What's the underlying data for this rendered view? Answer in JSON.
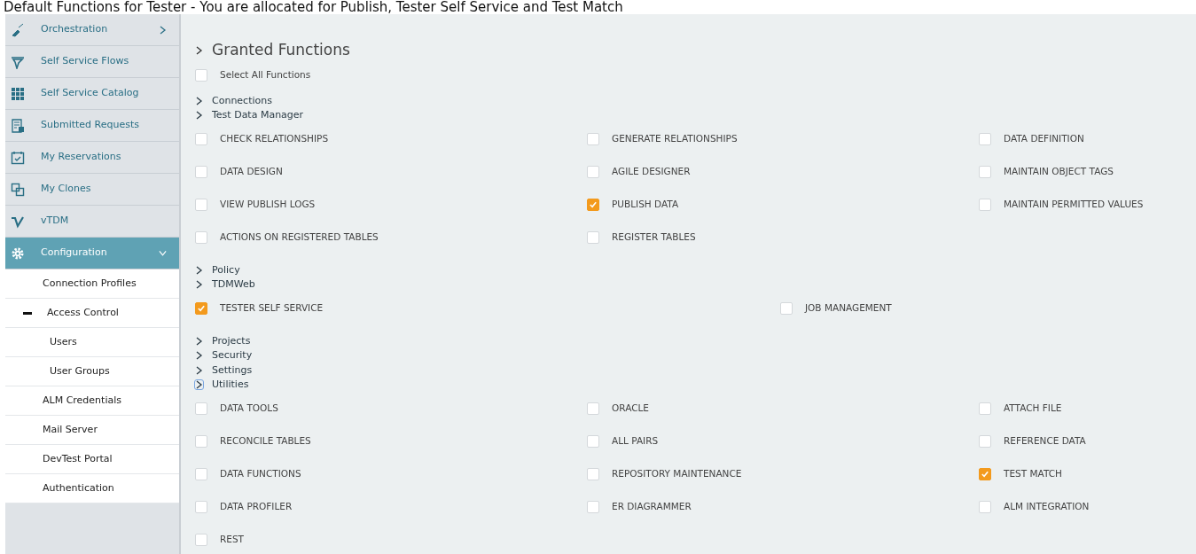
{
  "header": {
    "text": "Default Functions for Tester - You are allocated for Publish, Tester Self Service and Test Match"
  },
  "sidebar": {
    "items": [
      {
        "label": "Orchestration",
        "expanded": false,
        "selected": false
      },
      {
        "label": "Self Service Flows",
        "selected": false
      },
      {
        "label": "Self Service Catalog",
        "selected": false
      },
      {
        "label": "Submitted Requests",
        "selected": false
      },
      {
        "label": "My Reservations",
        "selected": false
      },
      {
        "label": "My Clones",
        "selected": false
      },
      {
        "label": "vTDM",
        "selected": false
      },
      {
        "label": "Configuration",
        "expanded": true,
        "selected": true,
        "children": [
          {
            "label": "Connection Profiles"
          },
          {
            "label": "Access Control",
            "expanded": true,
            "children": [
              {
                "label": "Users"
              },
              {
                "label": "User Groups"
              }
            ]
          },
          {
            "label": "ALM Credentials"
          },
          {
            "label": "Mail Server"
          },
          {
            "label": "DevTest Portal"
          },
          {
            "label": "Authentication"
          }
        ]
      }
    ]
  },
  "main": {
    "title": "Granted Functions",
    "select_all": {
      "label": "Select All Functions",
      "checked": false
    },
    "groups": [
      {
        "label": "Connections",
        "focused": false
      },
      {
        "label": "Test Data Manager",
        "focused": false,
        "items": [
          {
            "label": "CHECK RELATIONSHIPS",
            "checked": false
          },
          {
            "label": "GENERATE RELATIONSHIPS",
            "checked": false
          },
          {
            "label": "DATA DEFINITION",
            "checked": false
          },
          {
            "label": "DATA DESIGN",
            "checked": false
          },
          {
            "label": "AGILE DESIGNER",
            "checked": false
          },
          {
            "label": "MAINTAIN OBJECT TAGS",
            "checked": false
          },
          {
            "label": "VIEW PUBLISH LOGS",
            "checked": false
          },
          {
            "label": "PUBLISH DATA",
            "checked": true
          },
          {
            "label": "MAINTAIN PERMITTED VALUES",
            "checked": false
          },
          {
            "label": "ACTIONS ON REGISTERED TABLES",
            "checked": false
          },
          {
            "label": "REGISTER TABLES",
            "checked": false
          }
        ]
      },
      {
        "label": "Policy",
        "focused": false
      },
      {
        "label": "TDMWeb",
        "focused": false,
        "items": [
          {
            "label": "TESTER SELF SERVICE",
            "checked": true
          },
          {
            "label": "JOB MANAGEMENT",
            "checked": false
          }
        ]
      },
      {
        "label": "Projects",
        "focused": false
      },
      {
        "label": "Security",
        "focused": false
      },
      {
        "label": "Settings",
        "focused": false
      },
      {
        "label": "Utilities",
        "focused": true,
        "items": [
          {
            "label": "DATA TOOLS",
            "checked": false
          },
          {
            "label": "ORACLE",
            "checked": false
          },
          {
            "label": "ATTACH FILE",
            "checked": false
          },
          {
            "label": "RECONCILE TABLES",
            "checked": false
          },
          {
            "label": "ALL PAIRS",
            "checked": false
          },
          {
            "label": "REFERENCE DATA",
            "checked": false
          },
          {
            "label": "DATA FUNCTIONS",
            "checked": false
          },
          {
            "label": "REPOSITORY MAINTENANCE",
            "checked": false
          },
          {
            "label": "TEST MATCH",
            "checked": true
          },
          {
            "label": "DATA PROFILER",
            "checked": false
          },
          {
            "label": "ER DIAGRAMMER",
            "checked": false
          },
          {
            "label": "ALM INTEGRATION",
            "checked": false
          },
          {
            "label": "REST",
            "checked": false
          }
        ]
      }
    ]
  }
}
